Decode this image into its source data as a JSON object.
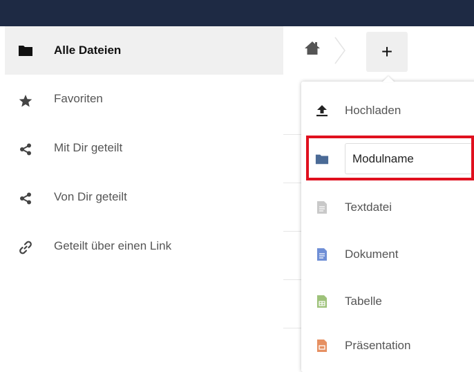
{
  "sidebar": {
    "items": [
      {
        "label": "Alle Dateien",
        "icon": "folder-icon",
        "active": true
      },
      {
        "label": "Favoriten",
        "icon": "star-icon"
      },
      {
        "label": "Mit Dir geteilt",
        "icon": "share-icon"
      },
      {
        "label": "Von Dir geteilt",
        "icon": "share-icon"
      },
      {
        "label": "Geteilt über einen Link",
        "icon": "link-icon"
      }
    ]
  },
  "breadcrumb": {
    "home_icon": "home-icon",
    "add_label": "+"
  },
  "new_menu": {
    "items": [
      {
        "label": "Hochladen",
        "icon": "upload-icon"
      },
      {
        "label": "Modulname",
        "icon": "folder-icon",
        "editing": true
      },
      {
        "label": "Textdatei",
        "icon": "text-file-icon"
      },
      {
        "label": "Dokument",
        "icon": "document-icon"
      },
      {
        "label": "Tabelle",
        "icon": "spreadsheet-icon"
      },
      {
        "label": "Präsentation",
        "icon": "presentation-icon"
      }
    ]
  },
  "colors": {
    "topbar": "#1e2a44",
    "highlight": "#e0101e",
    "folder_blue": "#4a6a96",
    "document_blue": "#6f8fd6",
    "spreadsheet_green": "#9ec27a",
    "presentation_orange": "#e69062"
  }
}
